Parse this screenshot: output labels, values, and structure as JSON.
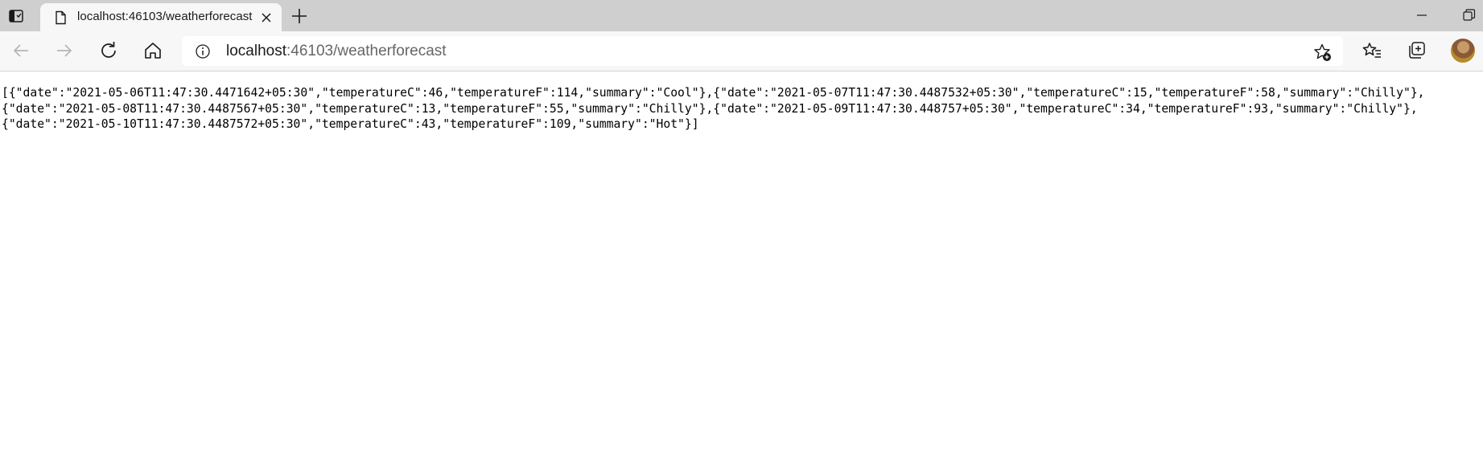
{
  "tab": {
    "title": "localhost:46103/weatherforecast"
  },
  "address_bar": {
    "host": "localhost",
    "rest": ":46103/weatherforecast"
  },
  "page": {
    "lines": [
      "[{\"date\":\"2021-05-06T11:47:30.4471642+05:30\",\"temperatureC\":46,\"temperatureF\":114,\"summary\":\"Cool\"},{\"date\":\"2021-05-07T11:47:30.4487532+05:30\",\"temperatureC\":15,\"temperatureF\":58,\"summary\":\"Chilly\"},",
      "{\"date\":\"2021-05-08T11:47:30.4487567+05:30\",\"temperatureC\":13,\"temperatureF\":55,\"summary\":\"Chilly\"},{\"date\":\"2021-05-09T11:47:30.448757+05:30\",\"temperatureC\":34,\"temperatureF\":93,\"summary\":\"Chilly\"},",
      "{\"date\":\"2021-05-10T11:47:30.4487572+05:30\",\"temperatureC\":43,\"temperatureF\":109,\"summary\":\"Hot\"}]"
    ]
  },
  "icons": {
    "tab_actions": "tab-actions-icon",
    "favicon": "page-icon",
    "close": "close-icon",
    "new_tab": "plus-icon",
    "minimize": "minimize-icon",
    "restore": "restore-icon",
    "back": "arrow-left-icon",
    "forward": "arrow-right-icon",
    "refresh": "refresh-icon",
    "home": "home-icon",
    "site_info": "info-icon",
    "add_favorite": "star-add-icon",
    "favorites": "favorites-icon",
    "collections": "collections-icon"
  },
  "colors": {
    "tab_strip": "#cfcfcf",
    "toolbar": "#f7f7f7",
    "icon": "#1a1a1a",
    "icon_disabled": "#b5b5b5"
  }
}
